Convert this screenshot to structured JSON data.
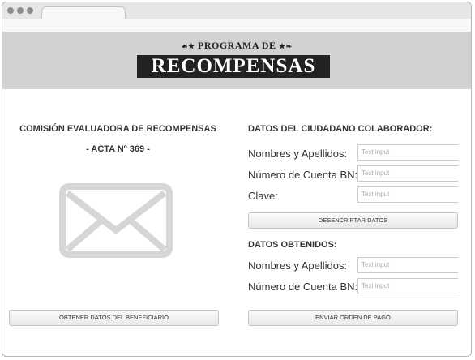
{
  "header": {
    "subtitle": "PROGRAMA DE",
    "title": "RECOMPENSAS",
    "ornament_left": "☙★",
    "ornament_right": "★❧"
  },
  "left": {
    "title": "COMISIÓN EVALUADORA DE RECOMPENSAS",
    "acta": "- ACTA Nº 369 -",
    "button_label": "OBTENER DATOS DEL BENEFICIARIO",
    "icon": "mail-icon"
  },
  "right": {
    "citizen_section_title": "DATOS DEL CIUDADANO COLABORADOR:",
    "citizen_fields": [
      {
        "label": "Nombres y Apellidos:",
        "placeholder": "Text input"
      },
      {
        "label": "Número de Cuenta BN:",
        "placeholder": "Text input"
      },
      {
        "label": "Clave:",
        "placeholder": "Text input"
      }
    ],
    "decrypt_button": "DESENCRIPTAR DATOS",
    "obtained_section_title": "DATOS OBTENIDOS:",
    "obtained_fields": [
      {
        "label": "Nombres y Apellidos:",
        "placeholder": "Text input"
      },
      {
        "label": "Número de Cuenta BN:",
        "placeholder": "Text input"
      }
    ],
    "send_button": "ENVIAR ORDEN DE PAGO"
  },
  "colors": {
    "banner_bg": "#d2d2d2",
    "title_bg": "#222222",
    "icon_gray": "#d6d6d6"
  }
}
